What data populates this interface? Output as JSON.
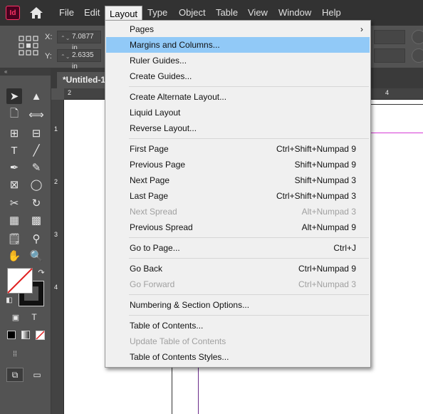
{
  "app": {
    "logo_text": "Id"
  },
  "menubar": {
    "items": [
      "File",
      "Edit",
      "Layout",
      "Type",
      "Object",
      "Table",
      "View",
      "Window",
      "Help"
    ]
  },
  "control": {
    "x_label": "X:",
    "y_label": "Y:",
    "x_value": "7.0877 in",
    "y_value": "2.6335 in"
  },
  "document": {
    "tab_title": "*Untitled-1",
    "h_ruler": [
      "2",
      "4"
    ],
    "v_ruler": [
      "1",
      "2",
      "3",
      "4"
    ],
    "guide_color": "#d63ad6",
    "margin_color": "#6a2b8a"
  },
  "toolbox": {
    "collapse_label": "«"
  },
  "layout_menu": {
    "items": [
      {
        "label": "Pages",
        "shortcut": "",
        "submenu": true,
        "disabled": false
      },
      {
        "label": "Margins and Columns...",
        "shortcut": "",
        "disabled": false,
        "highlighted": true
      },
      {
        "label": "Ruler Guides...",
        "shortcut": "",
        "disabled": false
      },
      {
        "label": "Create Guides...",
        "shortcut": "",
        "disabled": false
      },
      {
        "label": "Create Alternate Layout...",
        "shortcut": "",
        "disabled": false
      },
      {
        "label": "Liquid Layout",
        "shortcut": "",
        "disabled": false
      },
      {
        "label": "Reverse Layout...",
        "shortcut": "",
        "disabled": false
      },
      {
        "label": "First Page",
        "shortcut": "Ctrl+Shift+Numpad 9",
        "disabled": false
      },
      {
        "label": "Previous Page",
        "shortcut": "Shift+Numpad 9",
        "disabled": false
      },
      {
        "label": "Next Page",
        "shortcut": "Shift+Numpad 3",
        "disabled": false
      },
      {
        "label": "Last Page",
        "shortcut": "Ctrl+Shift+Numpad 3",
        "disabled": false
      },
      {
        "label": "Next Spread",
        "shortcut": "Alt+Numpad 3",
        "disabled": true
      },
      {
        "label": "Previous Spread",
        "shortcut": "Alt+Numpad 9",
        "disabled": false
      },
      {
        "label": "Go to Page...",
        "shortcut": "Ctrl+J",
        "disabled": false
      },
      {
        "label": "Go Back",
        "shortcut": "Ctrl+Numpad 9",
        "disabled": false
      },
      {
        "label": "Go Forward",
        "shortcut": "Ctrl+Numpad 3",
        "disabled": true
      },
      {
        "label": "Numbering & Section Options...",
        "shortcut": "",
        "disabled": false
      },
      {
        "label": "Table of Contents...",
        "shortcut": "",
        "disabled": false
      },
      {
        "label": "Update Table of Contents",
        "shortcut": "",
        "disabled": true
      },
      {
        "label": "Table of Contents Styles...",
        "shortcut": "",
        "disabled": false
      }
    ]
  },
  "colors": {
    "highlight": "#91c9f7",
    "menubar": "#323232",
    "panel": "#535353",
    "logo_accent": "#ff3366"
  }
}
